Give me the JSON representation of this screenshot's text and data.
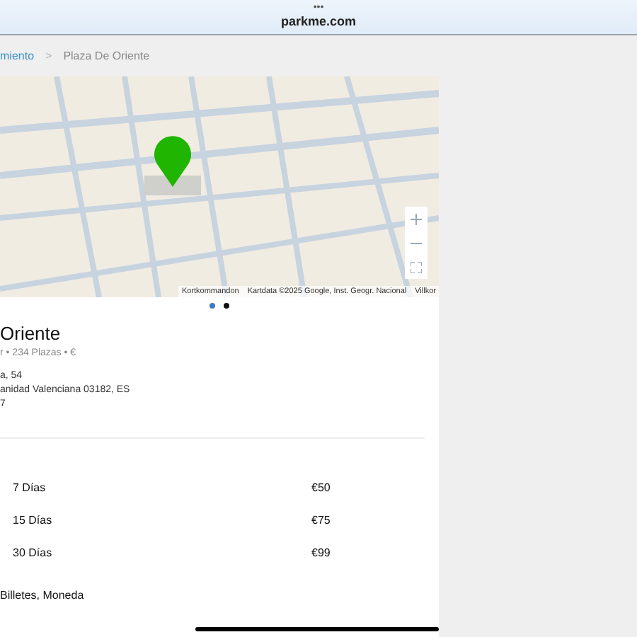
{
  "browser": {
    "menu": "•••",
    "url": "parkme.com"
  },
  "breadcrumb": [
    {
      "label": "miento",
      "kind": "link"
    },
    {
      "label": ">",
      "kind": "separator"
    },
    {
      "label": "Plaza De Oriente",
      "kind": "current"
    }
  ],
  "map": {
    "kind": "picture",
    "attribution": [
      "Kortkommandon",
      "Kartdata ©2025 Google, Inst. Geogr. Nacional",
      "Villkor"
    ]
  },
  "carousel_dots": [
    {
      "selected": true
    },
    {
      "selected": false
    }
  ],
  "title": "Oriente",
  "subtitle": "r • 234 Plazas • €",
  "address": [
    "a, 54",
    "anidad Valenciana 03182, ES",
    "7"
  ],
  "prices": [
    {
      "period": "7 Días",
      "price": "€50"
    },
    {
      "period": "15 Días",
      "price": "€75"
    },
    {
      "period": "30 Días",
      "price": "€99"
    }
  ],
  "payment": "Billetes, Moneda"
}
